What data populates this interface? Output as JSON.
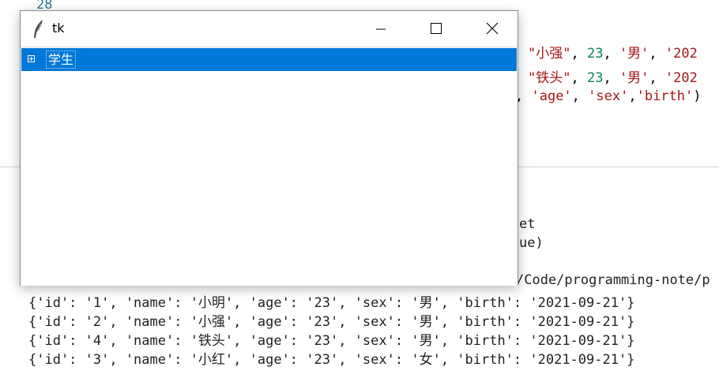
{
  "editor": {
    "line_number": "28",
    "row1": {
      "name": "\"小强\"",
      "age": "23",
      "sex": "'男'",
      "tail": "'202"
    },
    "row2": {
      "name": "\"铁头\"",
      "age": "23",
      "sex": "'男'",
      "tail": "'202"
    },
    "row3": {
      "lead": ", ",
      "f1": "'age'",
      "f2": "'sex'",
      "f3": "'birth'",
      "tail": ")"
    }
  },
  "terminal": {
    "partial1": "et",
    "partial2": "ue)",
    "path": "/Code/programming-note/p",
    "output": [
      "{'id': '1', 'name': '小明', 'age': '23', 'sex': '男', 'birth': '2021-09-21'}",
      "{'id': '2', 'name': '小强', 'age': '23', 'sex': '男', 'birth': '2021-09-21'}",
      "{'id': '4', 'name': '铁头', 'age': '23', 'sex': '男', 'birth': '2021-09-21'}",
      "{'id': '3', 'name': '小红', 'age': '23', 'sex': '女', 'birth': '2021-09-21'}"
    ]
  },
  "tk_window": {
    "title": "tk",
    "tree": {
      "root_label": "学生",
      "selected": true,
      "expanded": false
    }
  },
  "colors": {
    "selection": "#0078d7",
    "string": "#a31515",
    "number": "#098658",
    "line_number": "#237893"
  },
  "icons": [
    "feather-icon",
    "minimize-icon",
    "maximize-icon",
    "close-icon",
    "tree-expand-icon"
  ]
}
